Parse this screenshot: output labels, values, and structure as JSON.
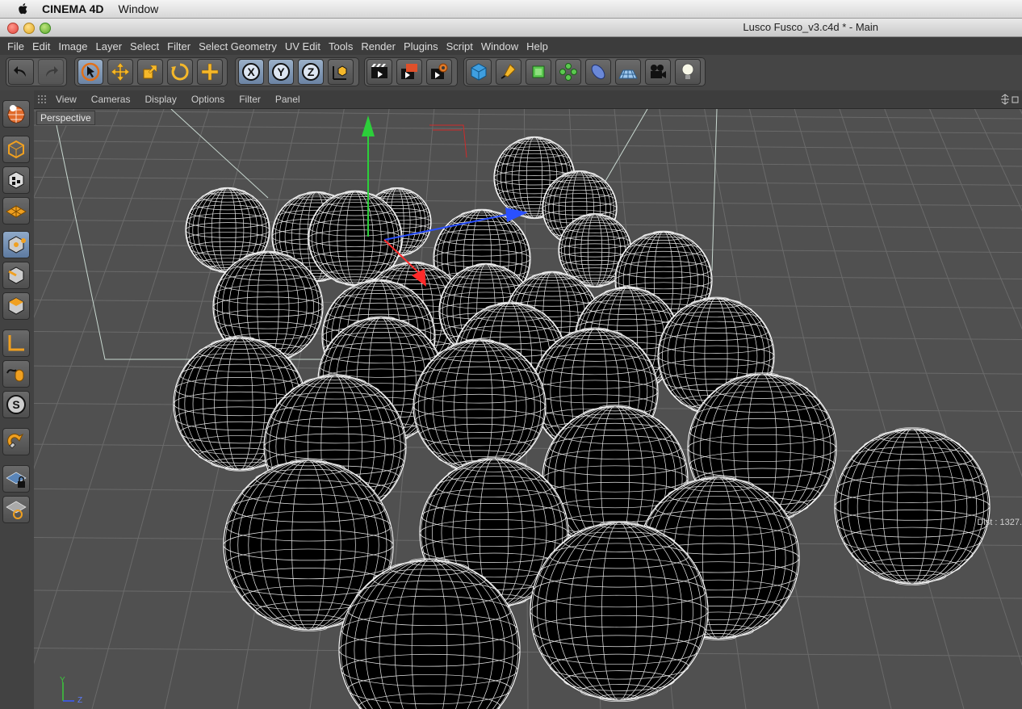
{
  "mac_menu": {
    "app_name": "CINEMA 4D",
    "window_menu": "Window"
  },
  "window": {
    "title": "Lusco Fusco_v3.c4d * - Main"
  },
  "menubar": [
    "File",
    "Edit",
    "Image",
    "Layer",
    "Select",
    "Filter",
    "Select Geometry",
    "UV Edit",
    "Tools",
    "Render",
    "Plugins",
    "Script",
    "Window",
    "Help"
  ],
  "toolbar": {
    "icons": [
      "undo-icon",
      "redo-icon",
      "live-selection-icon",
      "move-icon",
      "scale-icon",
      "rotate-icon",
      "last-tool-icon",
      "x-axis-icon",
      "y-axis-icon",
      "z-axis-icon",
      "world-coordinates-icon",
      "render-view-icon",
      "render-picture-viewer-icon",
      "render-settings-icon",
      "cube-primitive-icon",
      "pen-spline-icon",
      "subdivision-icon",
      "array-icon",
      "deformer-icon",
      "floor-environment-icon",
      "camera-icon",
      "light-icon"
    ],
    "axis_labels": [
      "X",
      "Y",
      "Z"
    ]
  },
  "sidebar": {
    "icons": [
      "make-editable-icon",
      "model-mode-icon",
      "texture-mode-icon",
      "workplane-mode-icon",
      "points-mode-icon",
      "edges-mode-icon",
      "polygons-mode-icon",
      "axis-mode-icon",
      "tweak-mode-icon",
      "solo-mode-icon",
      "snap-icon",
      "workplane-lock-icon",
      "workplane-align-icon"
    ],
    "solo_label": "S"
  },
  "viewport_menu": [
    "View",
    "Cameras",
    "Display",
    "Options",
    "Filter",
    "Panel"
  ],
  "viewport": {
    "label": "Perspective",
    "dist_readout": "Dist : 1327.",
    "axis_labels": [
      "Y",
      "Z"
    ]
  },
  "colors": {
    "accent_orange": "#f0a020",
    "accent_blue": "#5a8bd6",
    "grid": "#6a6a6a"
  }
}
